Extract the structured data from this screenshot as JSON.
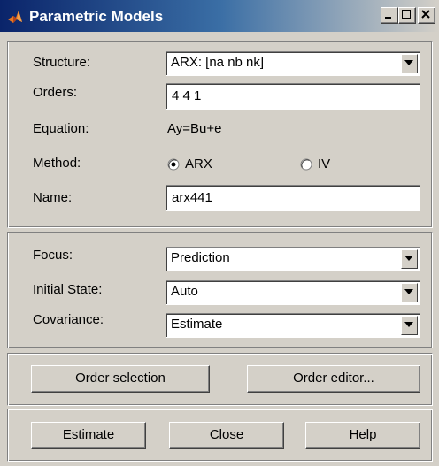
{
  "window": {
    "title": "Parametric Models",
    "controls": {
      "minimize": "_",
      "maximize": "□",
      "close": "X"
    }
  },
  "structure": {
    "structure_label": "Structure:",
    "structure_value": "ARX: [na nb nk]",
    "orders_label": "Orders:",
    "orders_value": "4 4 1",
    "equation_label": "Equation:",
    "equation_value": "Ay=Bu+e",
    "method_label": "Method:",
    "method_options": [
      "ARX",
      "IV"
    ],
    "method_selected": "ARX",
    "name_label": "Name:",
    "name_value": "arx441"
  },
  "estimation": {
    "focus_label": "Focus:",
    "focus_value": "Prediction",
    "initial_state_label": "Initial State:",
    "initial_state_value": "Auto",
    "covariance_label": "Covariance:",
    "covariance_value": "Estimate"
  },
  "order_buttons": {
    "order_selection": "Order selection",
    "order_editor": "Order editor..."
  },
  "actions": {
    "estimate": "Estimate",
    "close": "Close",
    "help": "Help"
  },
  "colors": {
    "face": "#d4d0c8",
    "title_active": "#0a246a",
    "title_gradient_end": "#a6caf0"
  }
}
